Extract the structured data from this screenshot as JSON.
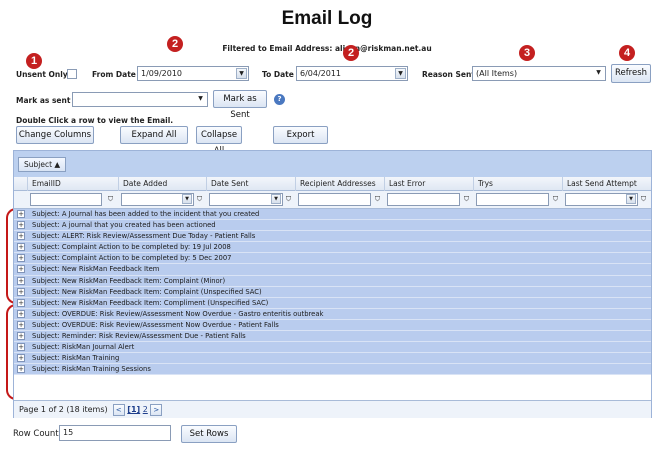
{
  "title": "Email Log",
  "filtered": "Filtered to Email Address: alison@riskman.net.au",
  "filters": {
    "unsent_only_label": "Unsent Only",
    "from_date_label": "From Date",
    "from_date_value": "1/09/2010",
    "to_date_label": "To Date",
    "to_date_value": "6/04/2011",
    "reason_label": "Reason Sent",
    "reason_value": "(All Items)",
    "refresh_label": "Refresh"
  },
  "mark": {
    "label": "Mark as sent",
    "value": "",
    "button": "Mark as Sent",
    "help": "?"
  },
  "hint": "Double Click a row to view the Email.",
  "actions": {
    "change_columns": "Change Columns",
    "expand_all": "Expand All",
    "collapse_all": "Collapse All",
    "export": "Export"
  },
  "badges": [
    "1",
    "2",
    "2",
    "3",
    "4"
  ],
  "grid": {
    "group_chip": "Subject ▲",
    "columns": [
      "EmailID",
      "Date Added",
      "Date Sent",
      "Recipient Addresses",
      "Last Error",
      "Trys",
      "Last Send Attempt"
    ],
    "rows": [
      "Subject: A Journal has been added to the incident that you created",
      "Subject: A journal that you created has been actioned",
      "Subject: ALERT: Risk Review/Assessment Due Today - Patient Falls",
      "Subject: Complaint Action to be completed by: 19 Jul 2008",
      "Subject: Complaint Action to be completed by: 5 Dec 2007",
      "Subject: New RiskMan Feedback Item",
      "Subject: New RiskMan Feedback Item: Complaint (Minor)",
      "Subject: New RiskMan Feedback Item: Complaint (Unspecified SAC)",
      "Subject: New RiskMan Feedback Item: Compliment (Unspecified SAC)",
      "Subject: OVERDUE: Risk Review/Assessment Now Overdue - Gastro enteritis outbreak",
      "Subject: OVERDUE: Risk Review/Assessment Now Overdue - Patient Falls",
      "Subject: Reminder: Risk Review/Assessment Due - Patient Falls",
      "Subject: RiskMan Journal Alert",
      "Subject: RiskMan Training",
      "Subject: RiskMan Training Sessions"
    ],
    "pager": {
      "text": "Page 1 of 2 (18 items)",
      "prev": "<",
      "current": "[1]",
      "page2": "2",
      "next": ">"
    }
  },
  "rowcount": {
    "label": "Row Count",
    "value": "15",
    "button": "Set Rows"
  },
  "colors": {
    "accent": "#c42020",
    "grid_row": "#b9ccee",
    "header_band": "#bcd0ef"
  }
}
